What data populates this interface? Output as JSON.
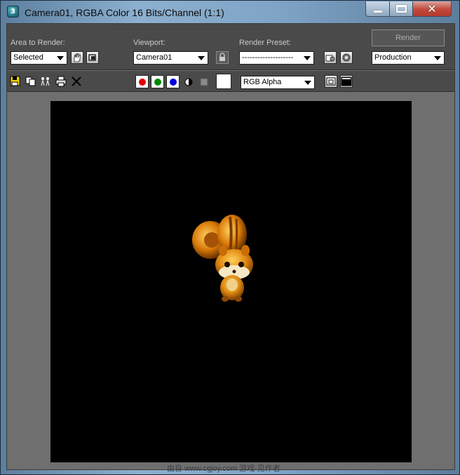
{
  "window": {
    "title": "Camera01, RGBA Color 16 Bits/Channel (1:1)",
    "app_icon": "3dsmax-icon",
    "buttons": [
      "minimize",
      "maximize",
      "close"
    ]
  },
  "toolbar": {
    "area_label": "Area to Render:",
    "area_value": "Selected",
    "viewport_label": "Viewport:",
    "viewport_value": "Camera01",
    "preset_label": "Render Preset:",
    "preset_value": "--------------------",
    "render_label": "Render",
    "mode_value": "Production"
  },
  "toolbar2": {
    "channel_value": "RGB Alpha",
    "colors": {
      "red": "#e00000",
      "green": "#008800",
      "blue": "#0000e0"
    }
  },
  "canvas": {
    "background": "#000000",
    "subject": "orange squirrel character"
  },
  "footer": {
    "watermark": "由自 www.cgjoy.com 游戏·见作者"
  }
}
